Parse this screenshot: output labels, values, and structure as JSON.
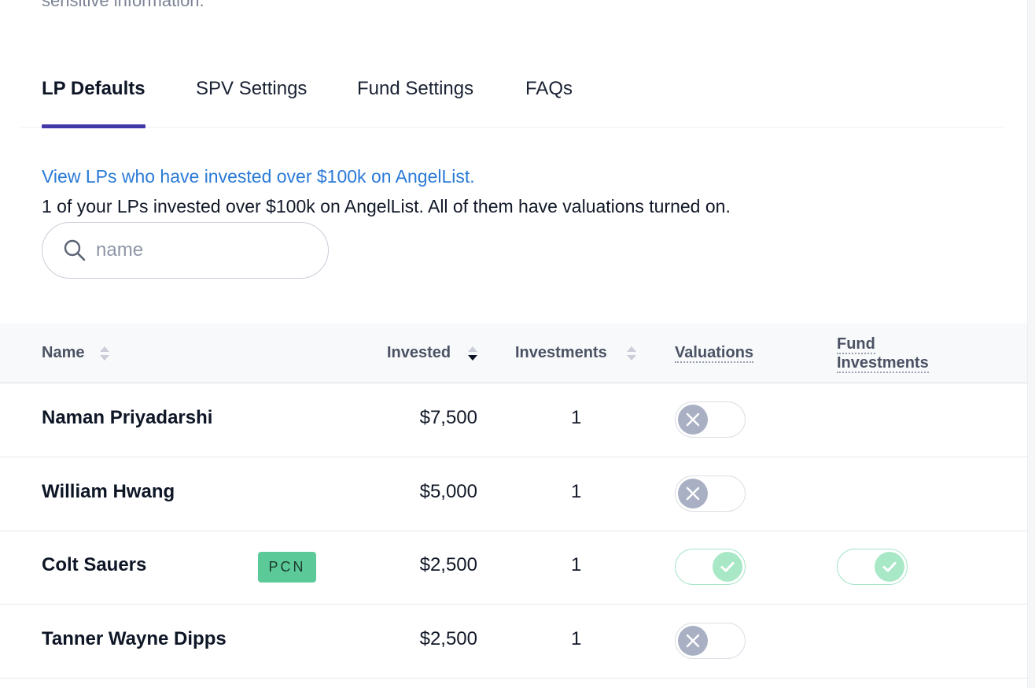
{
  "header": {
    "partial_text": "sensitive information."
  },
  "tabs": [
    {
      "label": "LP Defaults",
      "active": true
    },
    {
      "label": "SPV Settings",
      "active": false
    },
    {
      "label": "Fund Settings",
      "active": false
    },
    {
      "label": "FAQs",
      "active": false
    }
  ],
  "notice": {
    "link": "View LPs who have invested over $100k on AngelList.",
    "summary": "1 of your LPs invested over $100k on AngelList. All of them have valuations turned on."
  },
  "search": {
    "placeholder": "name",
    "icon": "search-icon"
  },
  "table": {
    "columns": {
      "name": "Name",
      "invested": "Invested",
      "investments": "Investments",
      "valuations": "Valuations",
      "fund_investments_line1": "Fund",
      "fund_investments_line2": "Investments"
    },
    "rows": [
      {
        "name": "Naman Priyadarshi",
        "badge": "",
        "invested": "$7,500",
        "investments": "1",
        "valuations": false,
        "fund_investments": null
      },
      {
        "name": "William Hwang",
        "badge": "",
        "invested": "$5,000",
        "investments": "1",
        "valuations": false,
        "fund_investments": null
      },
      {
        "name": "Colt Sauers",
        "badge": "PCN",
        "invested": "$2,500",
        "investments": "1",
        "valuations": true,
        "fund_investments": true
      },
      {
        "name": "Tanner Wayne Dipps",
        "badge": "",
        "invested": "$2,500",
        "investments": "1",
        "valuations": false,
        "fund_investments": null
      }
    ]
  },
  "colors": {
    "accent": "#4338a8",
    "link": "#2a7ad6",
    "badge": "#5cc998",
    "toggle_off_knob": "#a9b0c4",
    "toggle_on_knob": "#a9e8c6"
  }
}
